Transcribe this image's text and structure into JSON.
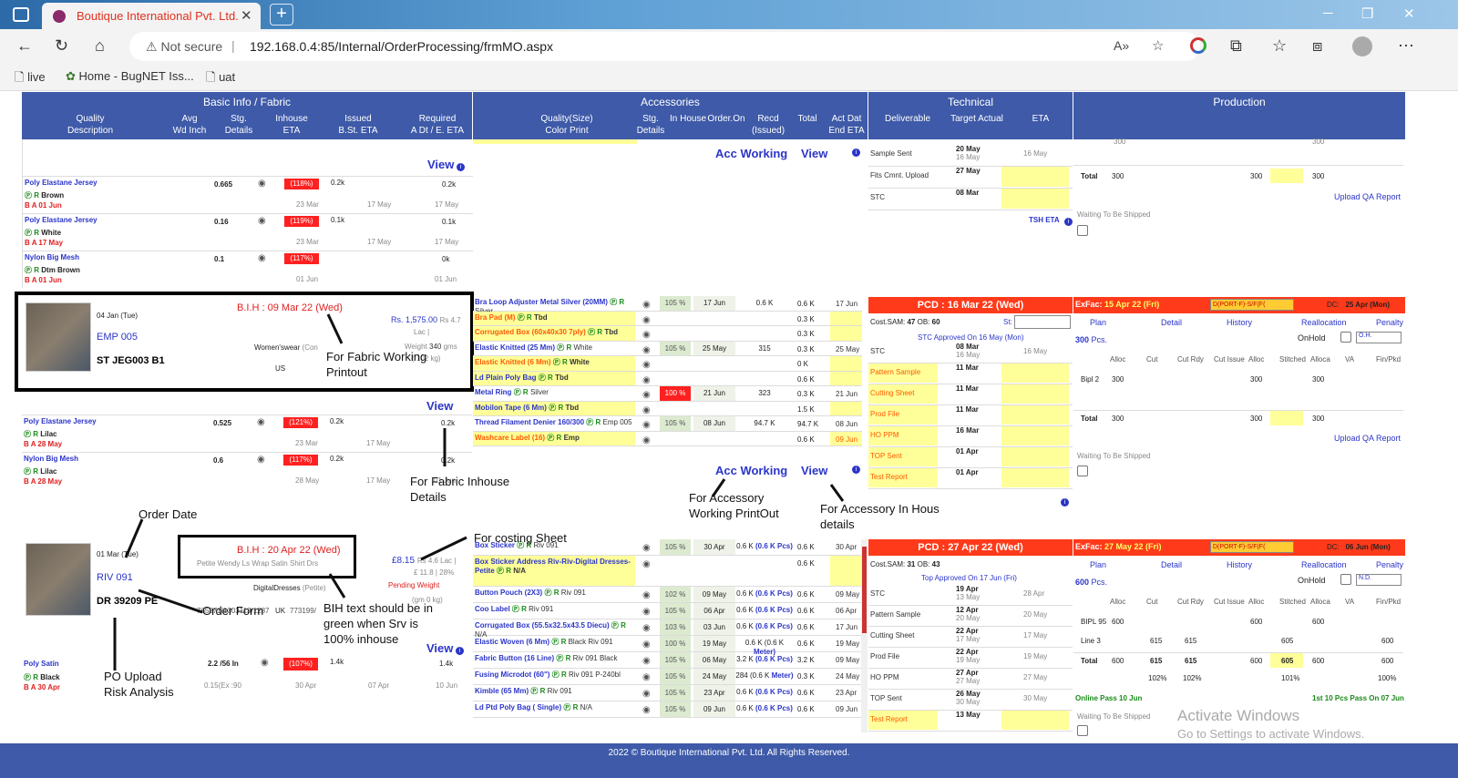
{
  "browser": {
    "tab_title": "Boutique International Pvt. Ltd.",
    "new_tab": "+",
    "not_secure": "Not secure",
    "url": "192.168.0.4:85/Internal/OrderProcessing/frmMO.aspx",
    "bookmarks": [
      "live",
      "Home - BugNET Iss...",
      "uat"
    ]
  },
  "header": {
    "basic": {
      "title": "Basic Info / Fabric",
      "cols": [
        [
          "Quality",
          "Description"
        ],
        [
          "Avg",
          "Wd Inch"
        ],
        [
          "Stg.",
          "Details"
        ],
        [
          "Inhouse",
          "ETA"
        ],
        [
          "Issued",
          "B.St. ETA"
        ],
        [
          "Required",
          "A Dt / E. ETA"
        ]
      ]
    },
    "acc": {
      "title": "Accessories",
      "cols": [
        [
          "Quality(Size)",
          "Color Print"
        ],
        [
          "Stg.",
          "Details"
        ],
        [
          "In House",
          ""
        ],
        [
          "Order.On",
          ""
        ],
        [
          "Recd",
          "(Issued)"
        ],
        [
          "Total",
          ""
        ],
        [
          "Act Dat",
          "End ETA"
        ]
      ]
    },
    "tech": {
      "title": "Technical",
      "cols": [
        "Deliverable",
        "Target Actual",
        "ETA"
      ]
    },
    "prod": {
      "title": "Production"
    }
  },
  "fabric1": [
    {
      "name": "Poly Elastane Jersey",
      "avg": "0.665",
      "pct": "(118%)",
      "iss": "0.2k",
      "req": "0.2k",
      "color": "Brown",
      "ba": "B A 01 Jun",
      "d1": "23 Mar",
      "d2": "17 May",
      "d3": "17 May"
    },
    {
      "name": "Poly Elastane Jersey",
      "avg": "0.16",
      "pct": "(119%)",
      "iss": "0.1k",
      "req": "0.1k",
      "color": "White",
      "ba": "B A 17 May",
      "d1": "23 Mar",
      "d2": "17 May",
      "d3": "17 May"
    },
    {
      "name": "Nylon Big Mesh",
      "avg": "0.1",
      "pct": "(117%)",
      "iss": "",
      "req": "0k",
      "color": "Dtm Brown",
      "ba": "B A 01 Jun",
      "d1": "01 Jun",
      "d2": "",
      "d3": "01 Jun"
    }
  ],
  "order1": {
    "date": "04 Jan (Tue)",
    "bih": "B.I.H : 09 Mar 22 (Wed)",
    "code": "EMP 005",
    "style": "ST JEG003 B1",
    "cat": "Women'swear",
    "cat2": "(Con",
    "cost": "Rs. 1,575.00",
    "cost2": "Rs 4.7",
    "lac": "Lac |",
    "weight": "Weight",
    "gms": "340",
    "gms_u": "gms",
    "kg": "( 102 kg)",
    "country": "US"
  },
  "fabric2": [
    {
      "name": "Poly Elastane Jersey",
      "avg": "0.525",
      "pct": "(121%)",
      "iss": "0.2k",
      "req": "0.2k",
      "color": "Lilac",
      "ba": "B A 28 May",
      "d1": "23 Mar",
      "d2": "17 May",
      "d3": ""
    },
    {
      "name": "Nylon Big Mesh",
      "avg": "0.6",
      "pct": "(117%)",
      "iss": "0.2k",
      "req": "0.2k",
      "color": "Lilac",
      "ba": "B A 28 May",
      "d1": "28 May",
      "d2": "17 May",
      "d3": "01 Jun"
    }
  ],
  "order2": {
    "date": "01 Mar (Tue)",
    "bih": "B.I.H : 20 Apr 22 (Wed)",
    "desc": "Petite Wendy Ls Wrap Satin Shirt Drs",
    "code": "RIV 091",
    "style": "DR 39209 PE",
    "cat": "DigitalDresses",
    "cat2": "(Petite)",
    "po": "765371/1303113/1287",
    "country": "UK",
    "po2": "773199/",
    "cost": "£8.15",
    "cost2": "Rs 4.6 Lac |",
    "cost3": "£ 11.8 | 28%",
    "pending": "Pending Weight",
    "kg": "(gm 0 kg)"
  },
  "fabric3": {
    "name": "Poly Satin",
    "avg": "2.2 /56 In",
    "pct": "(107%)",
    "iss": "1.4k",
    "req": "1.4k",
    "color": "Black",
    "ba": "B A 30 Apr",
    "ex": "0.15(Ex :90",
    "d1": "30 Apr",
    "d2": "07 Apr",
    "d3": "10 Jun"
  },
  "view_label": "View",
  "acc_working": "Acc Working",
  "acc1": [
    {
      "name": "Bra Loop Adjuster Metal Silver (20MM)",
      "color": "Silver",
      "pct": "105 %",
      "ord": "17 Jun",
      "recd": "0.6 K",
      "tot": "0.6 K",
      "eta": "17 Jun",
      "y": 0
    },
    {
      "name": "Bra Pad (M)",
      "color": "Tbd",
      "pct": "",
      "ord": "",
      "recd": "",
      "tot": "0.3 K",
      "eta": "",
      "y": 1,
      "o": 1
    },
    {
      "name": "Corrugated Box (60x40x30 7ply)",
      "color": "Tbd",
      "pct": "",
      "ord": "",
      "recd": "",
      "tot": "0.3 K",
      "eta": "",
      "y": 1,
      "o": 1
    },
    {
      "name": "Elastic Knitted (25 Mm)",
      "color": "White",
      "pct": "105 %",
      "ord": "25 May",
      "recd": "315",
      "tot": "0.3 K",
      "eta": "25 May",
      "y": 0
    },
    {
      "name": "Elastic Knitted (6 Mm)",
      "color": "White",
      "pct": "",
      "ord": "",
      "recd": "",
      "tot": "0 K",
      "eta": "",
      "y": 1,
      "o": 1
    },
    {
      "name": "Ld Plain Poly Bag",
      "color": "Tbd",
      "pct": "",
      "ord": "",
      "recd": "",
      "tot": "0.6 K",
      "eta": "",
      "y": 1,
      "o": 0
    },
    {
      "name": "Metal Ring",
      "color": "Silver",
      "pct": "100 %",
      "ord": "21 Jun",
      "recd": "323",
      "tot": "0.3 K",
      "eta": "21 Jun",
      "y": 0,
      "r": 1
    },
    {
      "name": "Mobilon Tape (6 Mm)",
      "color": "Tbd",
      "pct": "",
      "ord": "",
      "recd": "",
      "tot": "1.5 K",
      "eta": "",
      "y": 1,
      "o": 0
    },
    {
      "name": "Thread Filament Denier 160/300",
      "color": "Emp 005",
      "pct": "105 %",
      "ord": "08 Jun",
      "recd": "94.7 K",
      "tot": "94.7 K",
      "eta": "08 Jun",
      "y": 0
    },
    {
      "name": "Washcare Label (16)",
      "color": "Emp",
      "pct": "",
      "ord": "",
      "recd": "",
      "tot": "0.6 K",
      "eta": "09 Jun",
      "y": 1,
      "o": 1
    }
  ],
  "acc2": [
    {
      "name": "Box Sticker",
      "color": "Riv 091",
      "pct": "105 %",
      "ord": "30 Apr",
      "recd": "0.6 K",
      "recd2": "(0.6 K Pcs)",
      "tot": "0.6 K",
      "eta": "30 Apr"
    },
    {
      "name": "Box Sticker Address Riv-Riv-Digital Dresses-Petite",
      "color": "N/A",
      "pct": "",
      "ord": "",
      "recd": "",
      "recd2": "",
      "tot": "0.6 K",
      "eta": "",
      "y": 1
    },
    {
      "name": "Button Pouch (2X3)",
      "color": "Riv 091",
      "pct": "102 %",
      "ord": "09 May",
      "recd": "0.6 K",
      "recd2": "(0.6 K Pcs)",
      "tot": "0.6 K",
      "eta": "09 May"
    },
    {
      "name": "Coo Label",
      "color": "Riv 091",
      "pct": "105 %",
      "ord": "06 Apr",
      "recd": "0.6 K",
      "recd2": "(0.6 K Pcs)",
      "tot": "0.6 K",
      "eta": "06 Apr"
    },
    {
      "name": "Corrugated Box (55.5x32.5x43.5 Diecu)",
      "color": "N/A",
      "pct": "103 %",
      "ord": "03 Jun",
      "recd": "0.6 K",
      "recd2": "(0.6 K Pcs)",
      "tot": "0.6 K",
      "eta": "17 Jun"
    },
    {
      "name": "Elastic Woven (6 Mm)",
      "color": "Black Riv 091",
      "pct": "100 %",
      "ord": "19 May",
      "recd": "0.6 K (0.6 K",
      "recd2": "Meter)",
      "tot": "0.6 K",
      "eta": "19 May"
    },
    {
      "name": "Fabric Button (16 Line)",
      "color": "Riv 091 Black",
      "pct": "105 %",
      "ord": "06 May",
      "recd": "3.2 K",
      "recd2": "(0.6 K Pcs)",
      "tot": "3.2 K",
      "eta": "09 May"
    },
    {
      "name": "Fusing Microdot (60\")",
      "color": "Riv 091 P-240bl",
      "pct": "105 %",
      "ord": "24 May",
      "recd": "284 (0.6 K",
      "recd2": "Meter)",
      "tot": "0.3 K",
      "eta": "24 May"
    },
    {
      "name": "Kimble (65 Mm)",
      "color": "Riv 091",
      "pct": "105 %",
      "ord": "23 Apr",
      "recd": "0.6 K",
      "recd2": "(0.6 K Pcs)",
      "tot": "0.6 K",
      "eta": "23 Apr"
    },
    {
      "name": "Ld Ptd Poly Bag ( Single)",
      "color": "N/A",
      "pct": "105 %",
      "ord": "09 Jun",
      "recd": "0.6 K",
      "recd2": "(0.6 K Pcs)",
      "tot": "0.6 K",
      "eta": "09 Jun"
    }
  ],
  "tech0": [
    {
      "label": "Sample Sent",
      "t1": "20 May",
      "t2": "16 May",
      "eta": "16 May"
    },
    {
      "label": "Fits Cmnt. Upload",
      "t1": "27 May",
      "t2": "",
      "eta": ""
    },
    {
      "label": "STC",
      "t1": "08 Mar",
      "t2": "",
      "eta": ""
    }
  ],
  "tsh_eta": "TSH ETA",
  "tech1": {
    "pcd": "PCD : 16 Mar 22 (Wed)",
    "sam_l": "Cost.SAM:",
    "sam": "47",
    "ob_l": "OB:",
    "ob": "60",
    "st": "St:",
    "stc": "STC Approved On 16 May (Mon)",
    "rows": [
      {
        "label": "STC",
        "t1": "08 Mar",
        "t2": "16 May",
        "eta": "16 May",
        "o": 0
      },
      {
        "label": "Pattern Sample",
        "t1": "11 Mar",
        "t2": "",
        "eta": "",
        "o": 1
      },
      {
        "label": "Cutting Sheet",
        "t1": "11 Mar",
        "t2": "",
        "eta": "",
        "o": 1
      },
      {
        "label": "Prod File",
        "t1": "11 Mar",
        "t2": "",
        "eta": "",
        "o": 1
      },
      {
        "label": "HO PPM",
        "t1": "16 Mar",
        "t2": "",
        "eta": "",
        "o": 1
      },
      {
        "label": "TOP Sent",
        "t1": "01 Apr",
        "t2": "",
        "eta": "",
        "o": 1
      },
      {
        "label": "Test Report",
        "t1": "01 Apr",
        "t2": "",
        "eta": "",
        "o": 1
      }
    ]
  },
  "tech2": {
    "pcd": "PCD : 27 Apr 22 (Wed)",
    "sam_l": "Cost.SAM:",
    "sam": "31",
    "ob_l": "OB:",
    "ob": "43",
    "top": "Top Approved On 17 Jun (Fri)",
    "rows": [
      {
        "label": "STC",
        "t1": "19 Apr",
        "t2": "13 May",
        "eta": "28 Apr",
        "o": 0
      },
      {
        "label": "Pattern Sample",
        "t1": "12 Apr",
        "t2": "20 May",
        "eta": "20 May",
        "o": 0
      },
      {
        "label": "Cutting Sheet",
        "t1": "22 Apr",
        "t2": "17 May",
        "eta": "17 May",
        "o": 0
      },
      {
        "label": "Prod File",
        "t1": "22 Apr",
        "t2": "19 May",
        "eta": "19 May",
        "o": 0
      },
      {
        "label": "HO PPM",
        "t1": "27 Apr",
        "t2": "27 May",
        "eta": "27 May",
        "o": 0
      },
      {
        "label": "TOP Sent",
        "t1": "26 May",
        "t2": "30 May",
        "eta": "30 May",
        "o": 0
      },
      {
        "label": "Test Report",
        "t1": "13 May",
        "t2": "",
        "eta": "",
        "o": 1
      }
    ]
  },
  "prod0": {
    "total": "Total",
    "v1": "300",
    "v2": "300",
    "v3": "300",
    "top": "300",
    "upload": "Upload QA Report",
    "waiting": "Waiting To Be Shipped"
  },
  "prod1": {
    "exfac_l": "ExFac:",
    "exfac": "15 Apr 22 (Fri)",
    "mode": "D(PORT-F)-S/F(F(",
    "dc_l": "DC:",
    "dc": "25 Apr (Mon)",
    "links": [
      "Plan",
      "Detail",
      "History",
      "Reallocation",
      "Penalty"
    ],
    "pcs": "300",
    "pcs_l": "Pcs.",
    "onhold": "OnHold",
    "hold_sel": "O.H.",
    "cols": [
      "Alloc",
      "Cut",
      "Cut Rdy",
      "Cut Issue",
      "Alloc",
      "Stitched",
      "Alloca",
      "VA",
      "Fin/Pkd"
    ],
    "row_label": "Bipl 2",
    "r1": "300",
    "r2": "300",
    "r3": "300",
    "total": "Total",
    "t1": "300",
    "t2": "300",
    "t3": "300",
    "upload": "Upload QA Report",
    "waiting": "Waiting To Be Shipped"
  },
  "prod2": {
    "exfac_l": "ExFac:",
    "exfac": "27 May 22 (Fri)",
    "mode": "D(PORT-F)-S/F(F(",
    "dc_l": "DC:",
    "dc": "06 Jun (Mon)",
    "links": [
      "Plan",
      "Detail",
      "History",
      "Reallocation",
      "Penalty"
    ],
    "pcs": "600",
    "pcs_l": "Pcs.",
    "onhold": "OnHold",
    "hold_sel": "N.D.",
    "cols": [
      "Alloc",
      "Cut",
      "Cut Rdy",
      "Cut Issue",
      "Alloc",
      "Stitched",
      "Alloca",
      "VA",
      "Fin/Pkd"
    ],
    "rowA": "BIPL 95",
    "a1": "600",
    "a2": "600",
    "a3": "600",
    "rowB": "Line 3",
    "b1": "615",
    "b2": "615",
    "b3": "605",
    "b4": "600",
    "total": "Total",
    "t1": "600",
    "t2": "615",
    "t3": "615",
    "t4": "600",
    "t5": "605",
    "t6": "600",
    "t7": "600",
    "p1": "102%",
    "p2": "102%",
    "p3": "101%",
    "p4": "100%",
    "online": "Online Pass 10 Jun",
    "first": "1st 10 Pcs Pass On 07 Jun",
    "waiting": "Waiting To Be Shipped"
  },
  "annotations": {
    "fabric_working": "For Fabric Working Printout",
    "fabric_inhouse": "For Fabric Inhouse Details",
    "order_date": "Order Date",
    "costing": "For costing Sheet",
    "order_form": "Order Form",
    "bih_text": "BIH text should be in green when Srv is 100% inhouse",
    "po_upload": "PO Upload",
    "risk": "Risk Analysis",
    "acc_working": "For Accessory Working PrintOut",
    "acc_inhouse": "For Accessory In Hous details"
  },
  "watermark": {
    "title": "Activate Windows",
    "sub": "Go to Settings to activate Windows."
  },
  "footer": "2022 © Boutique International Pvt. Ltd. All Rights Reserved."
}
